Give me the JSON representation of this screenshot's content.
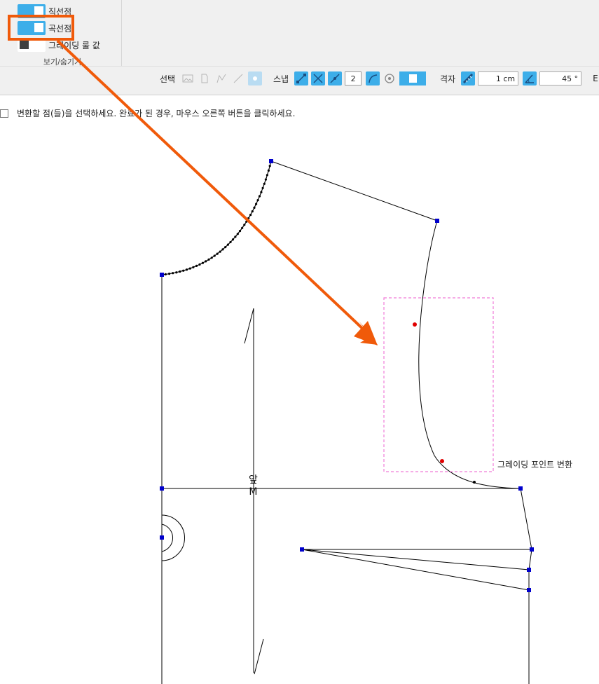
{
  "ribbon": {
    "view_group": {
      "items": [
        {
          "label": "직선점",
          "state": "on"
        },
        {
          "label": "곡선점",
          "state": "on"
        },
        {
          "label": "그레이딩 룰 값",
          "state": "off"
        }
      ],
      "group_label": "보기/숨기기"
    },
    "toolbar": {
      "select_label": "선택",
      "snap_label": "스냅",
      "snap_count": "2",
      "grid_label": "격자",
      "grid_size": "1 cm",
      "angle": "45 °",
      "trailing": "Ε"
    }
  },
  "instruction": "변환할 점(들)을 선택하세요. 완료가 된 경우, 마우스 오른쪽 버튼을 클릭하세요.",
  "canvas": {
    "piece_label_top": "앞",
    "piece_label_size": "M",
    "grading_label": "그레이딩 포인트 변환"
  },
  "colors": {
    "accent": "#3daee9",
    "highlight_box": "#f05a0a",
    "arrow": "#f05a0a",
    "point_blue": "#0000cc",
    "point_red": "#e00000",
    "selection_dash": "#f07cd8"
  }
}
